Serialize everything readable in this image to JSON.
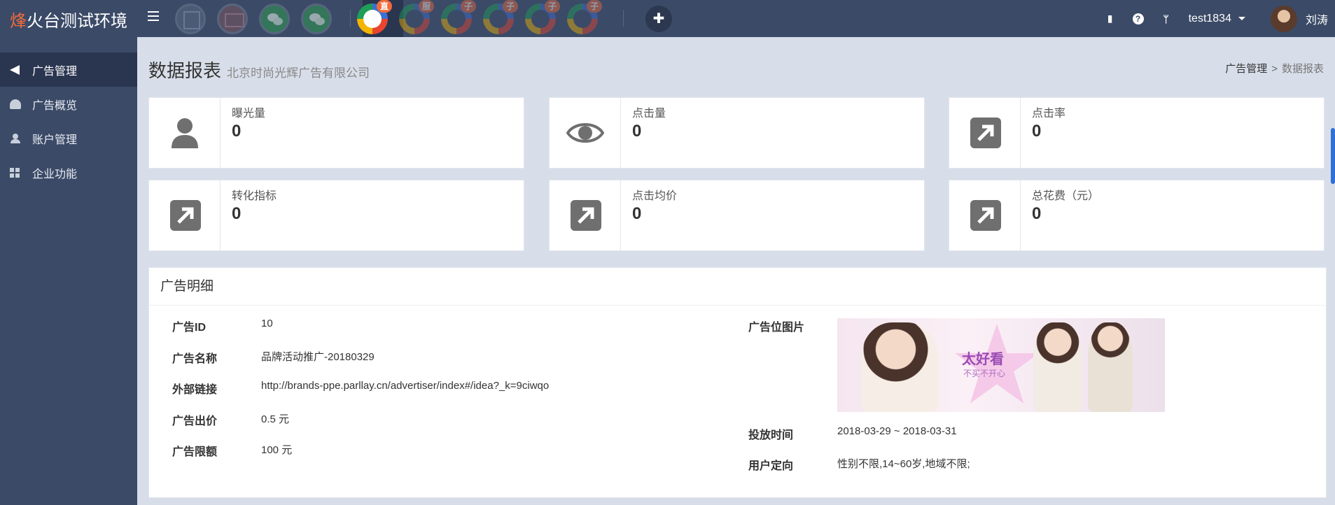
{
  "app": {
    "logo_prefix": "烽",
    "logo_rest": "火台测试环境"
  },
  "topbar": {
    "apps": [
      {
        "name": "app-1",
        "badge": ""
      },
      {
        "name": "app-2",
        "badge": ""
      },
      {
        "name": "wechat-1",
        "badge": ""
      },
      {
        "name": "wechat-2",
        "badge": ""
      },
      {
        "name": "direct",
        "badge": "直"
      },
      {
        "name": "service",
        "badge": "服"
      },
      {
        "name": "sub-1",
        "badge": "子"
      },
      {
        "name": "sub-2",
        "badge": "子"
      },
      {
        "name": "sub-3",
        "badge": "子"
      },
      {
        "name": "sub-4",
        "badge": "子"
      }
    ],
    "plus_label": "✚",
    "username": "test1834",
    "person_name": "刘涛"
  },
  "sidebar": {
    "items": [
      {
        "label": "广告管理",
        "icon": "megaphone-icon",
        "active": true
      },
      {
        "label": "广告概览",
        "icon": "dashboard-icon",
        "active": false
      },
      {
        "label": "账户管理",
        "icon": "user-icon",
        "active": false
      },
      {
        "label": "企业功能",
        "icon": "grid-icon",
        "active": false
      }
    ]
  },
  "page": {
    "title": "数据报表",
    "subtitle": "北京时尚光辉广告有限公司",
    "breadcrumb": {
      "parent": "广告管理",
      "separator": ">",
      "current": "数据报表"
    }
  },
  "stats": [
    {
      "label": "曝光量",
      "value": "0",
      "icon": "person-icon"
    },
    {
      "label": "点击量",
      "value": "0",
      "icon": "eye-icon"
    },
    {
      "label": "点击率",
      "value": "0",
      "icon": "arrow-up-right-icon"
    },
    {
      "label": "转化指标",
      "value": "0",
      "icon": "arrow-up-right-icon"
    },
    {
      "label": "点击均价",
      "value": "0",
      "icon": "arrow-up-right-icon"
    },
    {
      "label": "总花费（元）",
      "value": "0",
      "icon": "arrow-up-right-icon"
    }
  ],
  "detail": {
    "title": "广告明细",
    "left": [
      {
        "key": "广告ID",
        "value": "10"
      },
      {
        "key": "广告名称",
        "value": "品牌活动推广-20180329"
      },
      {
        "key": "外部链接",
        "value": "http://brands-ppe.parllay.cn/advertiser/index#/idea?_k=9ciwqo"
      },
      {
        "key": "广告出价",
        "value": "0.5 元"
      },
      {
        "key": "广告限额",
        "value": "100 元"
      }
    ],
    "image_label": "广告位图片",
    "banner_title": "太好看",
    "banner_sub": "不买不开心",
    "right": [
      {
        "key": "投放时间",
        "value": "2018-03-29 ~ 2018-03-31"
      },
      {
        "key": "用户定向",
        "value": "性别不限,14~60岁,地域不限;"
      }
    ]
  }
}
